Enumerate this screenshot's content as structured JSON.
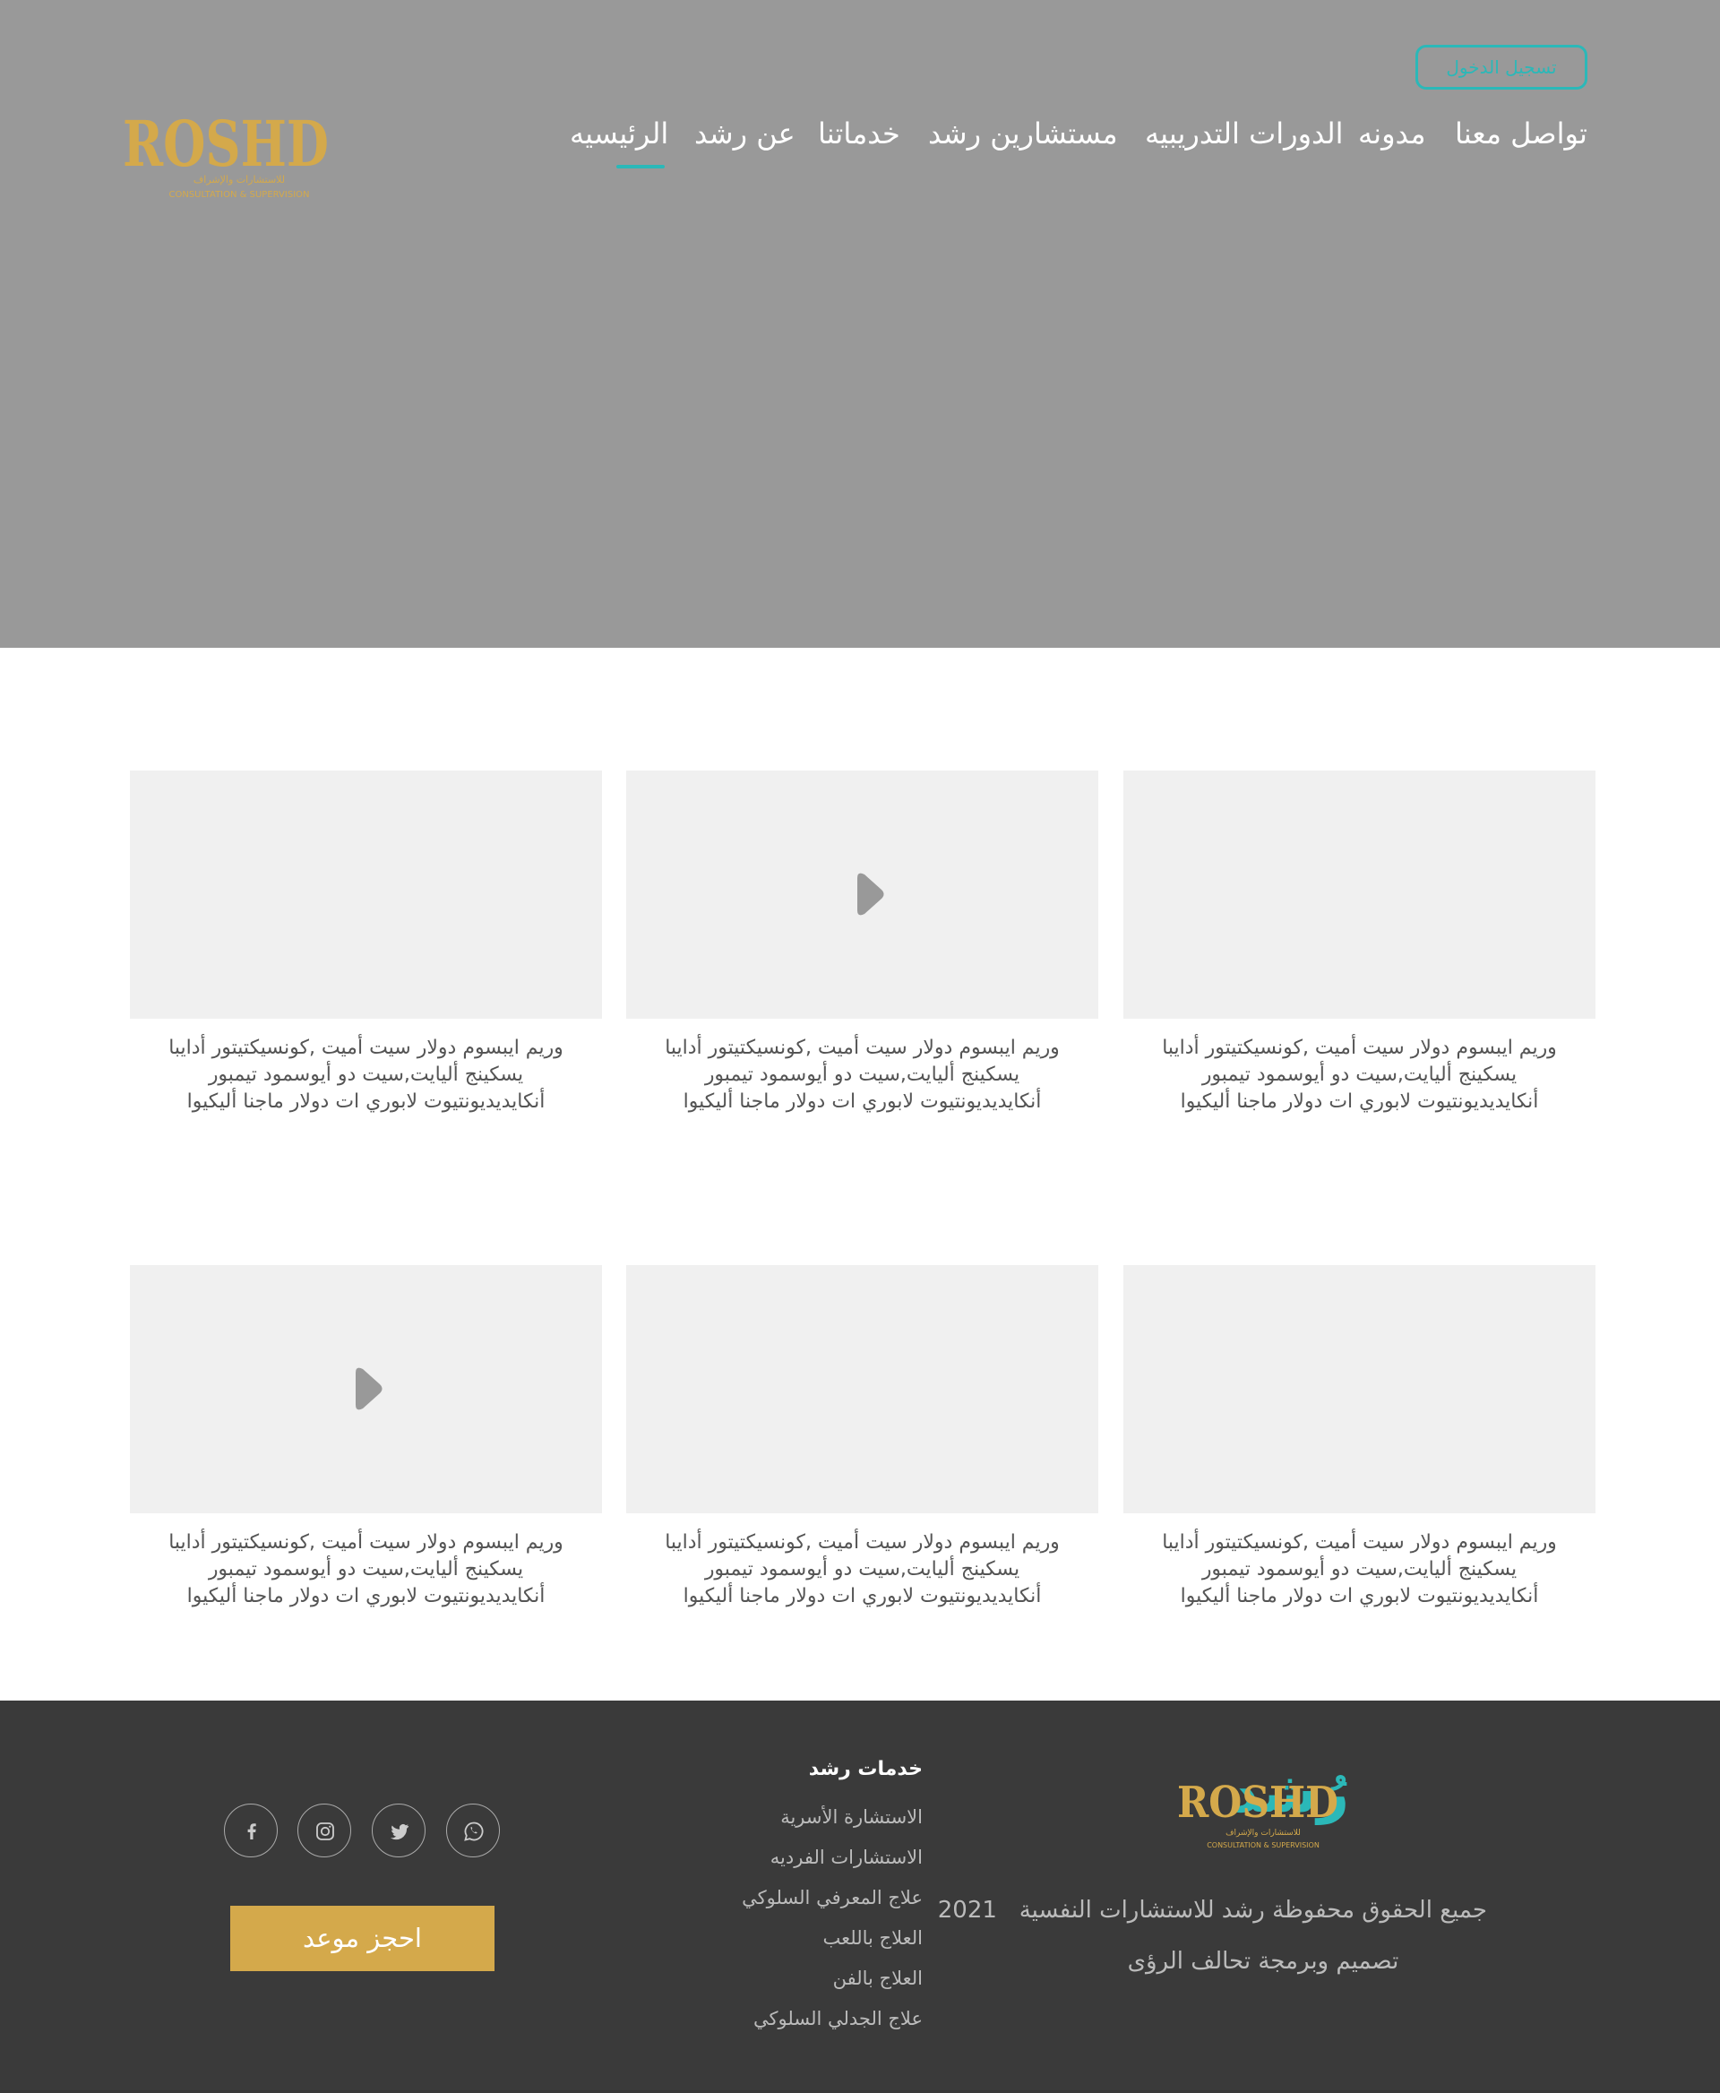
{
  "header": {
    "login_label": "تسجيل الدخول",
    "nav": [
      {
        "label": "تواصل معنا"
      },
      {
        "label": "مدونه"
      },
      {
        "label": "الدورات التدريبيه"
      },
      {
        "label": "مستشارين رشد"
      },
      {
        "label": "خدماتنا"
      },
      {
        "label": "عن رشد"
      },
      {
        "label": "الرئيسيه"
      }
    ],
    "active_nav": "الرئيسيه"
  },
  "logo": {
    "wordmark": "رُشد",
    "latin": "ROSHD",
    "subtitle_ar": "للاستشارات والإشراف",
    "subtitle_en": "CONSULTATION & SUPERVISION"
  },
  "cards": [
    {
      "text_lines": [
        "وريم ايبسوم دولار سيت أميت ,كونسيكتيتور أدايبا",
        "يسكينج أليايت,سيت دو أيوسمود تيمبور",
        "أنكايديديونتيوت لابوري ات دولار ماجنا أليكيوا"
      ],
      "has_play": false
    },
    {
      "text_lines": [
        "وريم ايبسوم دولار سيت أميت ,كونسيكتيتور أدايبا",
        "يسكينج أليايت,سيت دو أيوسمود تيمبور",
        "أنكايديديونتيوت لابوري ات دولار ماجنا أليكيوا"
      ],
      "has_play": true
    },
    {
      "text_lines": [
        "وريم ايبسوم دولار سيت أميت ,كونسيكتيتور أدايبا",
        "يسكينج أليايت,سيت دو أيوسمود تيمبور",
        "أنكايديديونتيوت لابوري ات دولار ماجنا أليكيوا"
      ],
      "has_play": false
    },
    {
      "text_lines": [
        "وريم ايبسوم دولار سيت أميت ,كونسيكتيتور أدايبا",
        "يسكينج أليايت,سيت دو أيوسمود تيمبور",
        "أنكايديديونتيوت لابوري ات دولار ماجنا أليكيوا"
      ],
      "has_play": false
    },
    {
      "text_lines": [
        "وريم ايبسوم دولار سيت أميت ,كونسيكتيتور أدايبا",
        "يسكينج أليايت,سيت دو أيوسمود تيمبور",
        "أنكايديديونتيوت لابوري ات دولار ماجنا أليكيوا"
      ],
      "has_play": false
    },
    {
      "text_lines": [
        "وريم ايبسوم دولار سيت أميت ,كونسيكتيتور أدايبا",
        "يسكينج أليايت,سيت دو أيوسمود تيمبور",
        "أنكايديديونتيوت لابوري ات دولار ماجنا أليكيوا"
      ],
      "has_play": true
    }
  ],
  "footer": {
    "copyright": "جميع الحقوق محفوظة رشد للاستشارات النفسية",
    "year": "2021",
    "credit": "تصميم وبرمجة تحالف الرؤى",
    "services_title": "خدمات رشد",
    "services": [
      "الاستشارة الأسرية",
      "الاستشارات الفرديه",
      "علاج المعرفي السلوكي",
      "العلاج باللعب",
      "العلاج بالفن",
      "علاج الجدلي السلوكي"
    ],
    "social": [
      "whatsapp-icon",
      "twitter-icon",
      "instagram-icon",
      "facebook-icon"
    ],
    "book_label": "احجز موعد"
  },
  "colors": {
    "teal": "#2bb8b8",
    "gold": "#d4a94b",
    "hero_gray": "#999999",
    "footer_bg": "#3a3a3a"
  }
}
